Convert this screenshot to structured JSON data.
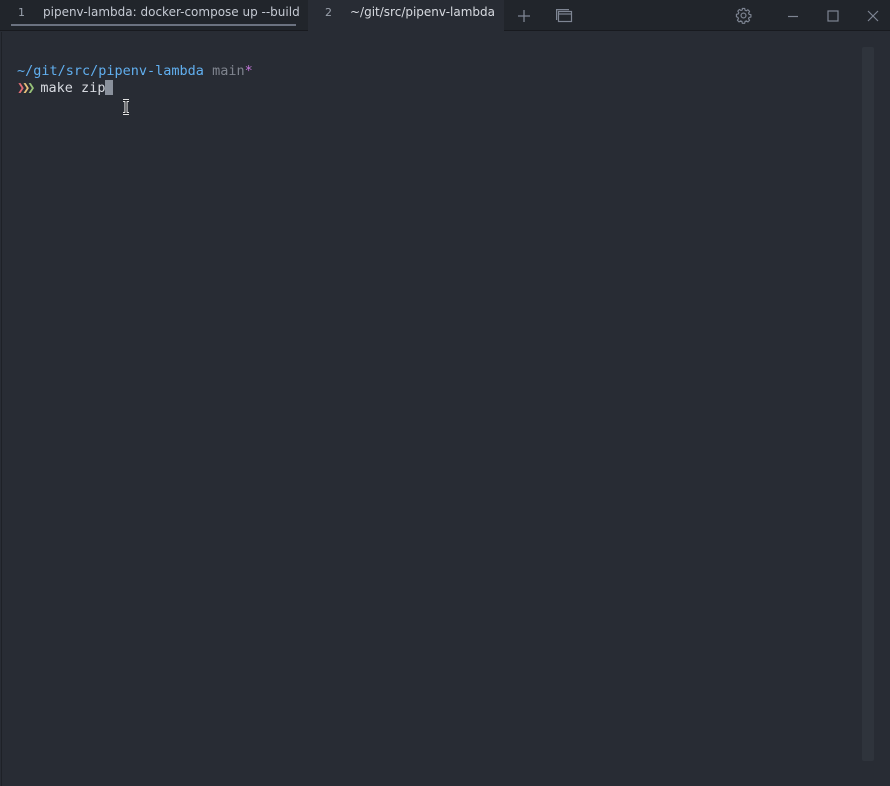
{
  "tabs": [
    {
      "number": "1",
      "title": "pipenv-lambda: docker-compose up --build"
    },
    {
      "number": "2",
      "title": "~/git/src/pipenv-lambda"
    }
  ],
  "toolbar": {
    "new_tab_icon": "plus-icon",
    "panes_icon": "panes-icon",
    "settings_icon": "gear-icon",
    "minimize_icon": "minimize-icon",
    "maximize_icon": "maximize-icon",
    "close_icon": "close-icon"
  },
  "terminal": {
    "prompt_path": "~/git/src/pipenv-lambda",
    "prompt_branch": "main",
    "prompt_dirty_marker": "*",
    "prompt_symbol": "❯❯❯",
    "command": "make zip"
  },
  "colors": {
    "background": "#282c34",
    "path": "#61afef",
    "chevron_1": "#e06c75",
    "chevron_2": "#e5c07b",
    "chevron_3": "#98c379"
  }
}
